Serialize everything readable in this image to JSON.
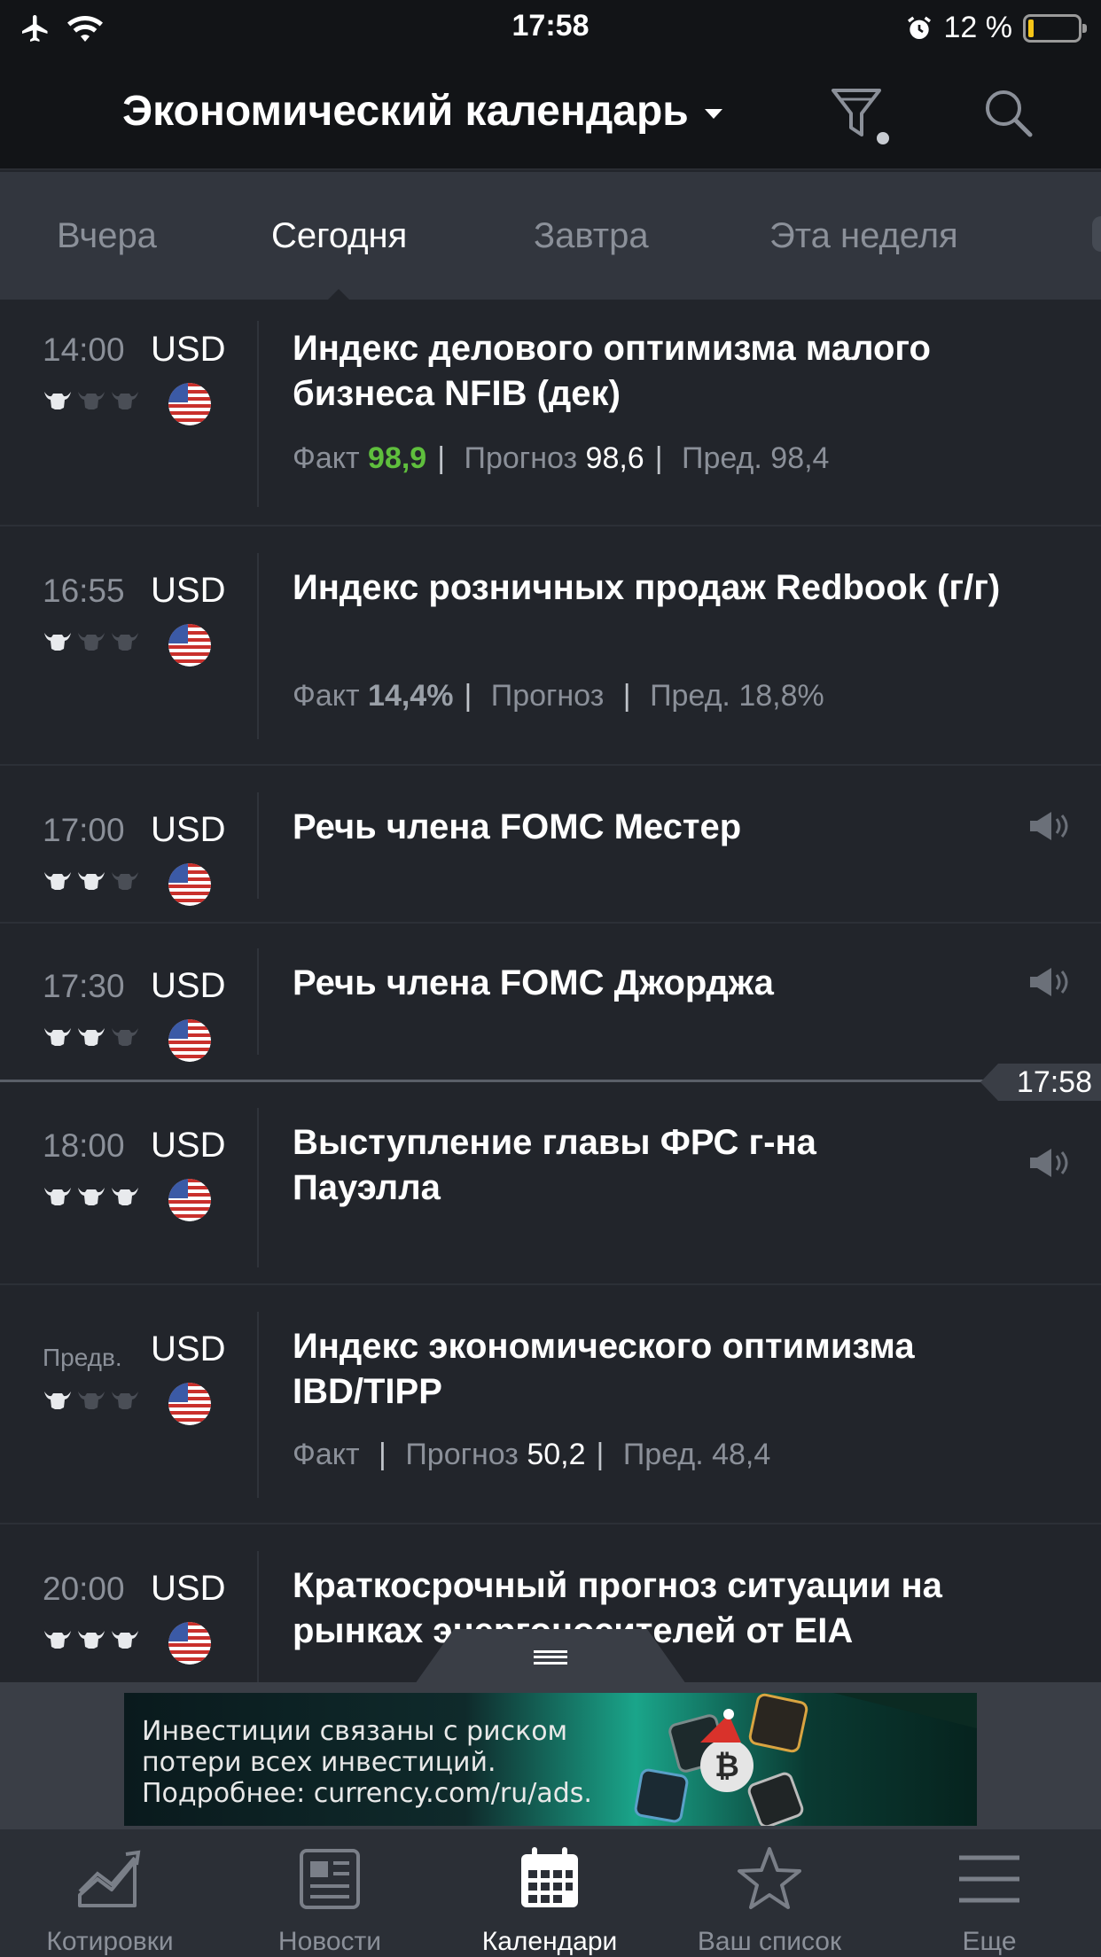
{
  "status_bar": {
    "time": "17:58",
    "battery": "12 %",
    "battery_level": 0.12,
    "icons": [
      "airplane-icon",
      "wifi-icon",
      "alarm-icon",
      "battery-icon"
    ]
  },
  "header": {
    "title": "Экономический календарь",
    "icons": [
      "filter-icon",
      "search-icon"
    ]
  },
  "tabs": [
    {
      "label": "Вчера",
      "active": false
    },
    {
      "label": "Сегодня",
      "active": true
    },
    {
      "label": "Завтра",
      "active": false
    },
    {
      "label": "Эта неделя",
      "active": false
    }
  ],
  "events": [
    {
      "time": "14:00",
      "currency": "USD",
      "importance": 1,
      "title": "Индекс делового оптимизма малого бизнеса NFIB (дек)",
      "actual_label": "Факт",
      "actual": "98,9",
      "forecast_label": "Прогноз",
      "forecast": "98,6",
      "previous_label": "Пред.",
      "previous": "98,4"
    },
    {
      "time": "16:55",
      "currency": "USD",
      "importance": 1,
      "title": "Индекс розничных продаж Redbook (г/г)",
      "actual_label": "Факт",
      "actual": "14,4%",
      "forecast_label": "Прогноз",
      "forecast": "",
      "previous_label": "Пред.",
      "previous": "18,8%"
    },
    {
      "time": "17:00",
      "currency": "USD",
      "importance": 2,
      "title": "Речь члена FOMC Местер",
      "speech": true
    },
    {
      "time": "17:30",
      "currency": "USD",
      "importance": 2,
      "title": "Речь члена FOMC Джорджа",
      "speech": true
    },
    {
      "time": "18:00",
      "currency": "USD",
      "importance": 3,
      "title": "Выступление главы ФРС г-на Пауэлла",
      "speech": true
    },
    {
      "time": "Предв.",
      "currency": "USD",
      "importance": 1,
      "title": "Индекс экономического оптимизма IBD/TIPP",
      "actual_label": "Факт",
      "actual": "",
      "forecast_label": "Прогноз",
      "forecast": "50,2",
      "previous_label": "Пред.",
      "previous": "48,4"
    },
    {
      "time": "20:00",
      "currency": "USD",
      "importance": 3,
      "title": "Краткосрочный прогноз ситуации на рынках энергоносителей от EIA"
    }
  ],
  "now_marker": "17:58",
  "ad": {
    "lines": [
      "Инвестиции связаны с риском",
      "потери всех инвестиций.",
      "Подробнее: currency.com/ru/ads."
    ]
  },
  "nav": [
    {
      "label": "Котировки",
      "icon": "quotes-chart-icon",
      "active": false
    },
    {
      "label": "Новости",
      "icon": "news-icon",
      "active": false
    },
    {
      "label": "Календари",
      "icon": "calendar-icon",
      "active": true
    },
    {
      "label": "Ваш список",
      "icon": "star-icon",
      "active": false
    },
    {
      "label": "Еще",
      "icon": "menu-icon",
      "active": false
    }
  ],
  "colors": {
    "background": "#22252b",
    "header": "#121417",
    "tabs": "#32363e",
    "actual_positive": "#5fbf3d"
  }
}
